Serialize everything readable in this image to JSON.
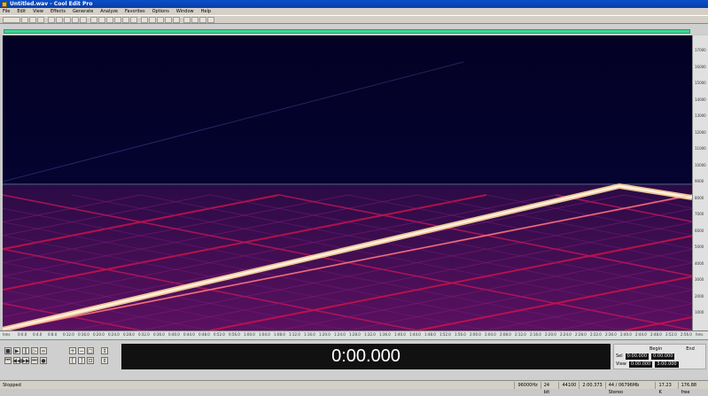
{
  "window": {
    "title": "Untitled.wav - Cool Edit Pro"
  },
  "menu": [
    "File",
    "Edit",
    "View",
    "Effects",
    "Generate",
    "Analyze",
    "Favorites",
    "Options",
    "Window",
    "Help"
  ],
  "toolbar": {
    "buttons": 24
  },
  "spectral": {
    "y_labels": [
      "17000",
      "16000",
      "15000",
      "14000",
      "13000",
      "12000",
      "11000",
      "10000",
      "9000",
      "8000",
      "7000",
      "6000",
      "5000",
      "4000",
      "3000",
      "2000",
      "1000"
    ],
    "x_labels": [
      "hms",
      "0:0.0",
      "0:4.0",
      "0:8.0",
      "0:12.0",
      "0:16.0",
      "0:20.0",
      "0:24.0",
      "0:28.0",
      "0:32.0",
      "0:36.0",
      "0:40.0",
      "0:44.0",
      "0:48.0",
      "0:52.0",
      "0:56.0",
      "1:00.0",
      "1:04.0",
      "1:08.0",
      "1:12.0",
      "1:16.0",
      "1:20.0",
      "1:24.0",
      "1:28.0",
      "1:32.0",
      "1:36.0",
      "1:40.0",
      "1:44.0",
      "1:48.0",
      "1:52.0",
      "1:56.0",
      "2:00.0",
      "2:04.0",
      "2:08.0",
      "2:12.0",
      "2:16.0",
      "2:20.0",
      "2:24.0",
      "2:28.0",
      "2:32.0",
      "2:36.0",
      "2:40.0",
      "2:44.0",
      "2:48.0",
      "2:52.0",
      "2:56.0",
      "hms"
    ]
  },
  "transport": {
    "time": "0:00.000",
    "begin_label": "Begin",
    "end_label": "End",
    "sel_label": "Sel",
    "view_label": "View",
    "sel_begin": "0:00.000",
    "sel_end": "0:00.000",
    "view_begin": "0:00.000",
    "view_end": "3:00.000"
  },
  "status": {
    "left": "Stopped",
    "cells": [
      "96000Hz",
      "24 bit",
      "44100",
      "2:00.373",
      "44 / 06796Mb Stereo",
      "17.23 K",
      "176.88 free"
    ]
  },
  "colors": {
    "background": "#040326",
    "hot": "#ffe3b5",
    "red": "#d0124a",
    "purple": "#6a146e"
  }
}
